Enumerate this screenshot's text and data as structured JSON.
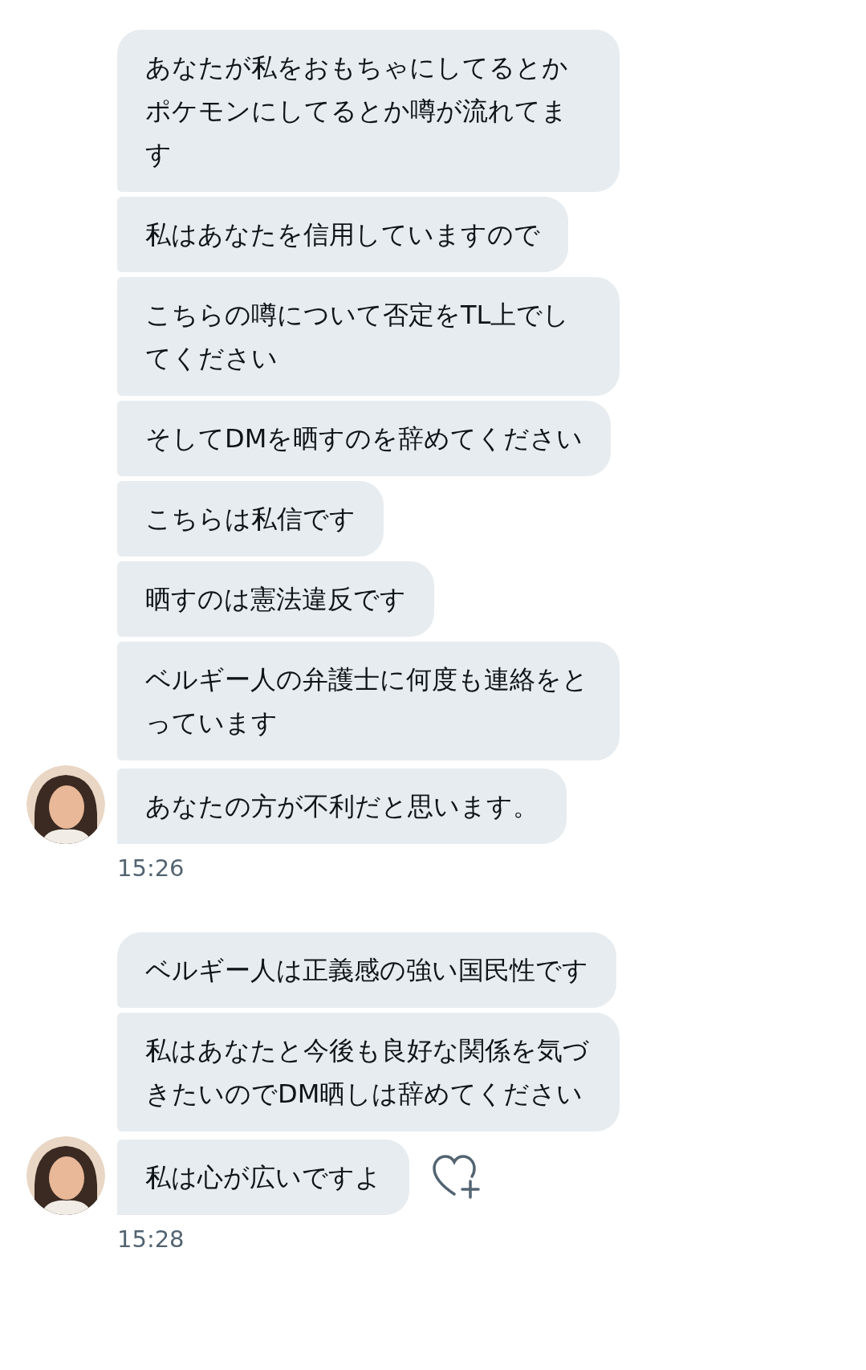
{
  "groups": [
    {
      "messages": [
        {
          "text": "あなたが私をおもちゃにしてるとかポケモンにしてるとか噂が流れてます"
        },
        {
          "text": "私はあなたを信用していますので"
        },
        {
          "text": "こちらの噂について否定をTL上でしてください"
        },
        {
          "text": "そしてDMを晒すのを辞めてください"
        },
        {
          "text": "こちらは私信です"
        },
        {
          "text": "晒すのは憲法違反です"
        },
        {
          "text": "ベルギー人の弁護士に何度も連絡をとっています"
        },
        {
          "text": "あなたの方が不利だと思います。"
        }
      ],
      "time": "15:26"
    },
    {
      "messages": [
        {
          "text": "ベルギー人は正義感の強い国民性です"
        },
        {
          "text": "私はあなたと今後も良好な関係を気づきたいのでDM晒しは辞めてください"
        },
        {
          "text": "私は心が広いですよ"
        }
      ],
      "time": "15:28"
    }
  ]
}
